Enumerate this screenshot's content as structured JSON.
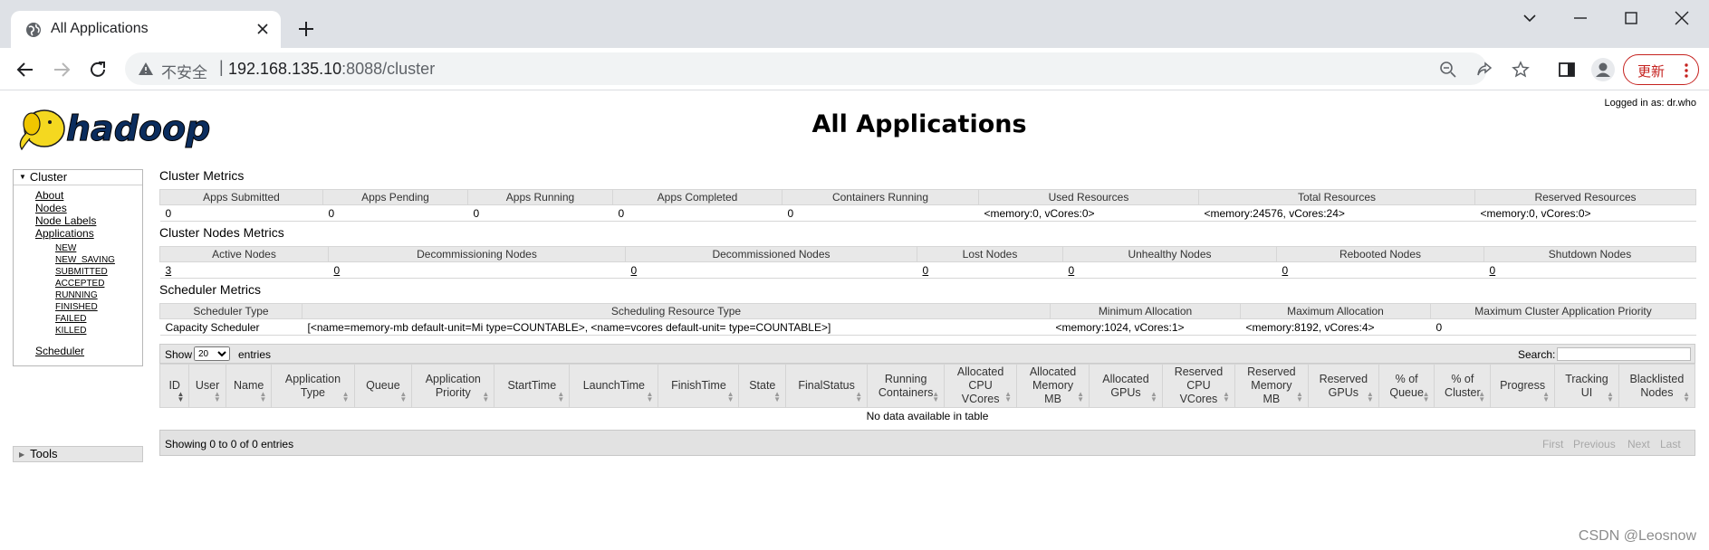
{
  "browser": {
    "tab_title": "All Applications",
    "insecure_label": "不安全",
    "separator": "|",
    "url_host": "192.168.135.10",
    "url_rest": ":8088/cluster",
    "update_label": "更新"
  },
  "page": {
    "title": "All Applications",
    "logged_in": "Logged in as: dr.who"
  },
  "sidebar": {
    "cluster_label": "Cluster",
    "links": [
      "About",
      "Nodes",
      "Node Labels",
      "Applications"
    ],
    "app_states": [
      "NEW",
      "NEW_SAVING",
      "SUBMITTED",
      "ACCEPTED",
      "RUNNING",
      "FINISHED",
      "FAILED",
      "KILLED"
    ],
    "scheduler_label": "Scheduler",
    "tools_label": "Tools"
  },
  "cluster_metrics": {
    "title": "Cluster Metrics",
    "headers": [
      "Apps Submitted",
      "Apps Pending",
      "Apps Running",
      "Apps Completed",
      "Containers Running",
      "Used Resources",
      "Total Resources",
      "Reserved Resources"
    ],
    "values": [
      "0",
      "0",
      "0",
      "0",
      "0",
      "<memory:0, vCores:0>",
      "<memory:24576, vCores:24>",
      "<memory:0, vCores:0>"
    ]
  },
  "node_metrics": {
    "title": "Cluster Nodes Metrics",
    "headers": [
      "Active Nodes",
      "Decommissioning Nodes",
      "Decommissioned Nodes",
      "Lost Nodes",
      "Unhealthy Nodes",
      "Rebooted Nodes",
      "Shutdown Nodes"
    ],
    "values": [
      "3",
      "0",
      "0",
      "0",
      "0",
      "0",
      "0"
    ]
  },
  "scheduler_metrics": {
    "title": "Scheduler Metrics",
    "headers": [
      "Scheduler Type",
      "Scheduling Resource Type",
      "Minimum Allocation",
      "Maximum Allocation",
      "Maximum Cluster Application Priority"
    ],
    "values": [
      "Capacity Scheduler",
      "[<name=memory-mb default-unit=Mi type=COUNTABLE>, <name=vcores default-unit= type=COUNTABLE>]",
      "<memory:1024, vCores:1>",
      "<memory:8192, vCores:4>",
      "0"
    ]
  },
  "apps_table": {
    "show_label": "Show",
    "page_size": "20",
    "entries_label": "entries",
    "search_label": "Search:",
    "columns": [
      [
        "ID"
      ],
      [
        "User"
      ],
      [
        "Name"
      ],
      [
        "Application",
        "Type"
      ],
      [
        "Queue"
      ],
      [
        "Application",
        "Priority"
      ],
      [
        "StartTime"
      ],
      [
        "LaunchTime"
      ],
      [
        "FinishTime"
      ],
      [
        "State"
      ],
      [
        "FinalStatus"
      ],
      [
        "Running",
        "Containers"
      ],
      [
        "Allocated",
        "CPU",
        "VCores"
      ],
      [
        "Allocated",
        "Memory",
        "MB"
      ],
      [
        "Allocated",
        "GPUs"
      ],
      [
        "Reserved",
        "CPU",
        "VCores"
      ],
      [
        "Reserved",
        "Memory",
        "MB"
      ],
      [
        "Reserved",
        "GPUs"
      ],
      [
        "% of",
        "Queue"
      ],
      [
        "% of",
        "Cluster"
      ],
      [
        "Progress"
      ],
      [
        "Tracking",
        "UI"
      ],
      [
        "Blacklisted",
        "Nodes"
      ]
    ],
    "empty_text": "No data available in table",
    "info_text": "Showing 0 to 0 of 0 entries",
    "pager": [
      "First",
      "Previous",
      "Next",
      "Last"
    ]
  },
  "watermark": "CSDN @Leosnow"
}
